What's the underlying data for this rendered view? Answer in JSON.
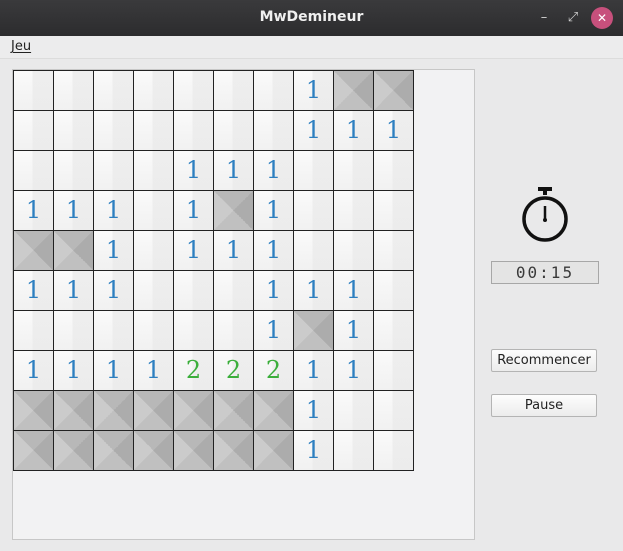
{
  "window": {
    "title": "MwDemineur",
    "min_symbol": "–",
    "max_symbol": "⤢",
    "close_symbol": "✕"
  },
  "menu": {
    "jeu_label": "Jeu"
  },
  "timer": {
    "display": "00:15"
  },
  "buttons": {
    "restart_label": "Recommencer",
    "pause_label": "Pause"
  },
  "colors": {
    "one": "#2d7fc0",
    "two": "#3bae3b",
    "hidden_cell": "#bdbdbd"
  },
  "board": {
    "rows": [
      [
        "",
        "",
        "",
        "",
        "",
        "",
        "",
        "1",
        "#",
        "#"
      ],
      [
        "",
        "",
        "",
        "",
        "",
        "",
        "",
        "1",
        "1",
        "1"
      ],
      [
        "",
        "",
        "",
        "",
        "1",
        "1",
        "1",
        "",
        "",
        ""
      ],
      [
        "1",
        "1",
        "1",
        "",
        "1",
        "#",
        "1",
        "",
        "",
        ""
      ],
      [
        "#",
        "#",
        "1",
        "",
        "1",
        "1",
        "1",
        "",
        "",
        ""
      ],
      [
        "1",
        "1",
        "1",
        "",
        "",
        "",
        "1",
        "1",
        "1",
        ""
      ],
      [
        "",
        "",
        "",
        "",
        "",
        "",
        "1",
        "#",
        "1",
        ""
      ],
      [
        "1",
        "1",
        "1",
        "1",
        "2",
        "2",
        "2",
        "1",
        "1",
        ""
      ],
      [
        "#",
        "#",
        "#",
        "#",
        "#",
        "#",
        "#",
        "1",
        "",
        ""
      ],
      [
        "#",
        "#",
        "#",
        "#",
        "#",
        "#",
        "#",
        "1",
        "",
        ""
      ]
    ]
  }
}
